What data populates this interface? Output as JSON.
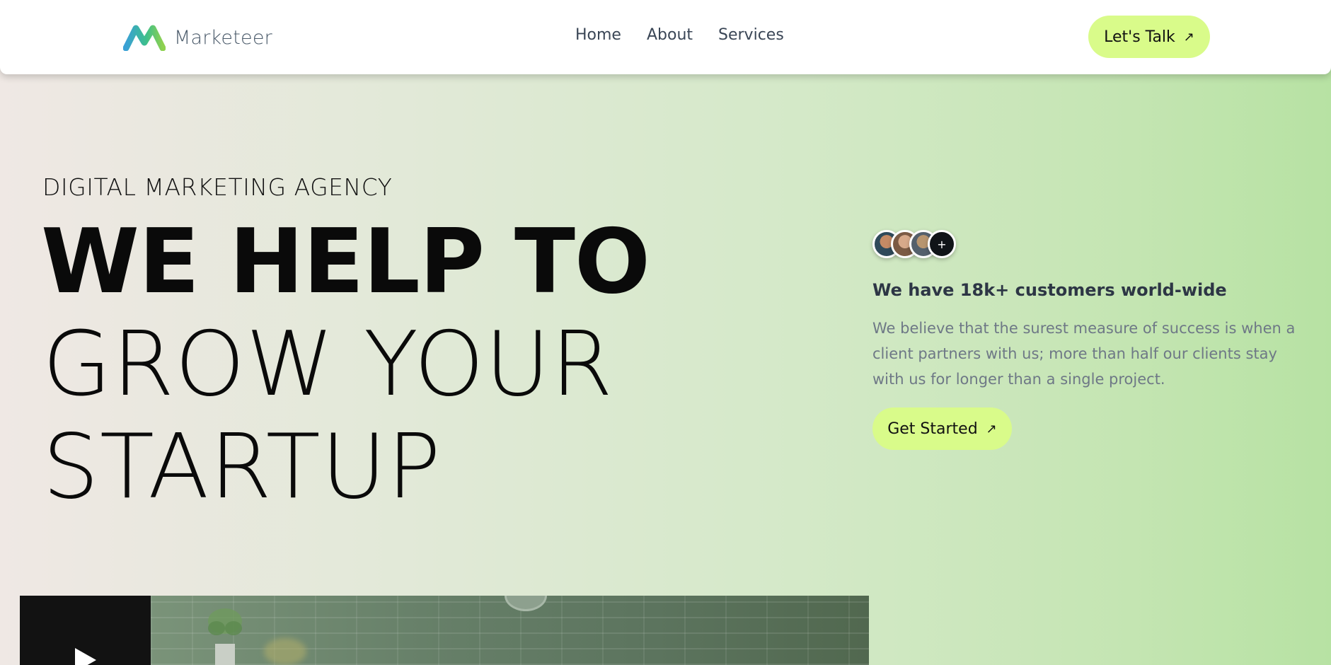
{
  "nav": {
    "brand": "Marketeer",
    "links": [
      "Home",
      "About",
      "Services"
    ],
    "cta_label": "Let's Talk",
    "cta_arrow": "↗"
  },
  "hero": {
    "eyebrow": "DIGITAL MARKETING AGENCY",
    "headline_line1": "WE HELP TO",
    "headline_line2": "GROW YOUR",
    "headline_line3": "STARTUP",
    "avatars": [
      "customer-avatar",
      "customer-avatar",
      "customer-avatar"
    ],
    "avatar_more": "+",
    "customers_title": "We have 18k+ customers world-wide",
    "description": "We believe that the surest measure of success is when a client partners with us; more than half our clients stay with us for longer than a single project.",
    "cta_label": "Get Started",
    "cta_arrow": "↗"
  },
  "video": {
    "play_icon": "play-icon"
  },
  "colors": {
    "accent": "#d9fb8a",
    "text_dark": "#0a0a0a",
    "text_muted": "#6e7886"
  }
}
